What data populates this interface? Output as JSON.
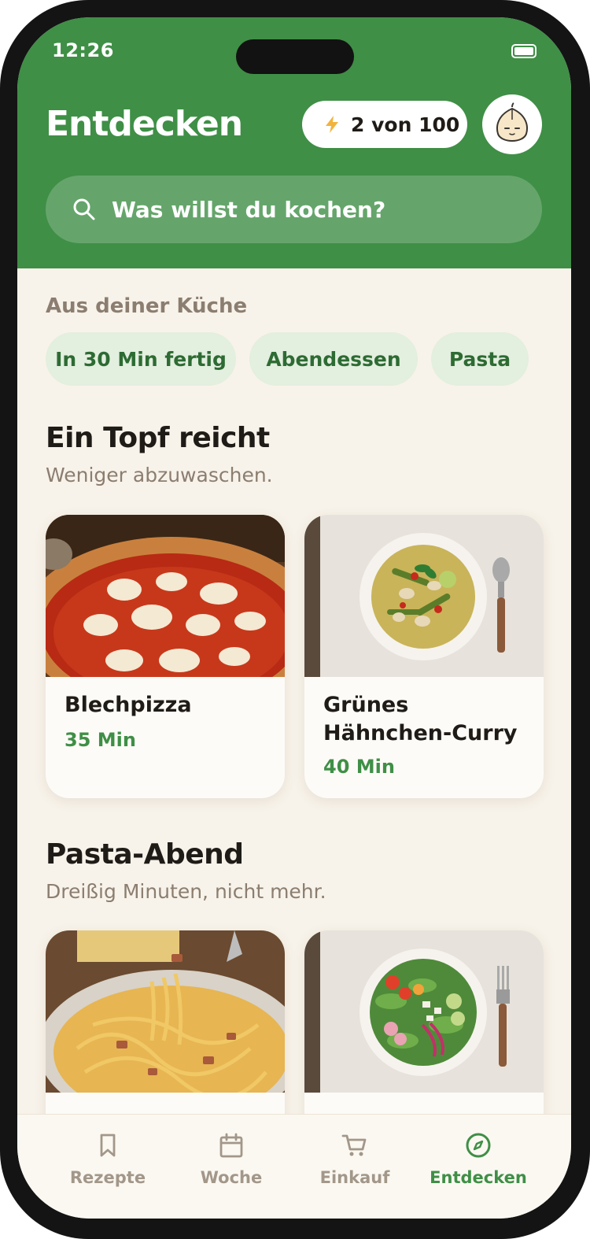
{
  "status_bar": {
    "time": "12:26"
  },
  "header": {
    "title": "Entdecken",
    "quota": "2 von 100",
    "avatar_icon": "onion-mascot-icon"
  },
  "search": {
    "placeholder": "Was willst du kochen?"
  },
  "kitchen": {
    "label": "Aus deiner Küche",
    "chips": [
      "In 30 Min fertig",
      "Abendessen",
      "Pasta"
    ]
  },
  "sections": [
    {
      "title": "Ein Topf reicht",
      "subtitle": "Weniger abzuwaschen.",
      "cards": [
        {
          "title": "Blechpizza",
          "time": "35 Min",
          "image": "pizza-photo"
        },
        {
          "title": "Grünes Hähnchen-Curry",
          "time": "40 Min",
          "image": "curry-photo"
        }
      ]
    },
    {
      "title": "Pasta-Abend",
      "subtitle": "Dreißig Minuten, nicht mehr.",
      "cards": [
        {
          "title": "",
          "time": "",
          "image": "carbonara-photo"
        },
        {
          "title": "",
          "time": "",
          "image": "salad-photo"
        }
      ]
    }
  ],
  "tabs": [
    {
      "label": "Rezepte",
      "icon": "bookmark-icon",
      "active": false
    },
    {
      "label": "Woche",
      "icon": "calendar-icon",
      "active": false
    },
    {
      "label": "Einkauf",
      "icon": "cart-icon",
      "active": false
    },
    {
      "label": "Entdecken",
      "icon": "compass-icon",
      "active": true
    }
  ],
  "colors": {
    "brand_green": "#3f8f46",
    "background": "#f8f3ea",
    "chip_bg": "#e3efdf",
    "muted_text": "#8b7e70"
  }
}
